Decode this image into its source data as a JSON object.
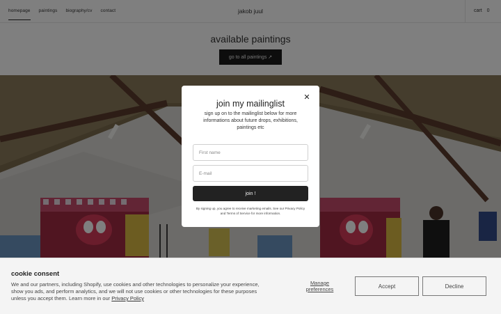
{
  "header": {
    "nav": [
      "homepage",
      "paintings",
      "biography/cv",
      "contact"
    ],
    "brand": "jakob juul",
    "cart_label": "cart",
    "cart_count": "0"
  },
  "section": {
    "title": "available paintings",
    "cta": "go to all paintings ↗"
  },
  "modal": {
    "title": "join my mailinglist",
    "subtitle": "sign up on to the mailinglist below for more informations about future drops, exhibitions, paintings etc",
    "name_placeholder": "First name",
    "email_placeholder": "E-mail",
    "join_label": "join !",
    "legal": "By signing up, you agree to receive marketing emails. See our Privacy Policy and Terms of Service for more information.",
    "close_icon": "close-icon"
  },
  "cookie": {
    "title": "cookie consent",
    "body": "We and our partners, including Shopify, use cookies and other technologies to personalize your experience, show you ads, and perform analytics, and we will not use cookies or other technologies for these purposes unless you accept them. Learn more in our",
    "link": "Privacy Policy",
    "manage": "Manage preferences",
    "accept": "Accept",
    "decline": "Decline"
  }
}
